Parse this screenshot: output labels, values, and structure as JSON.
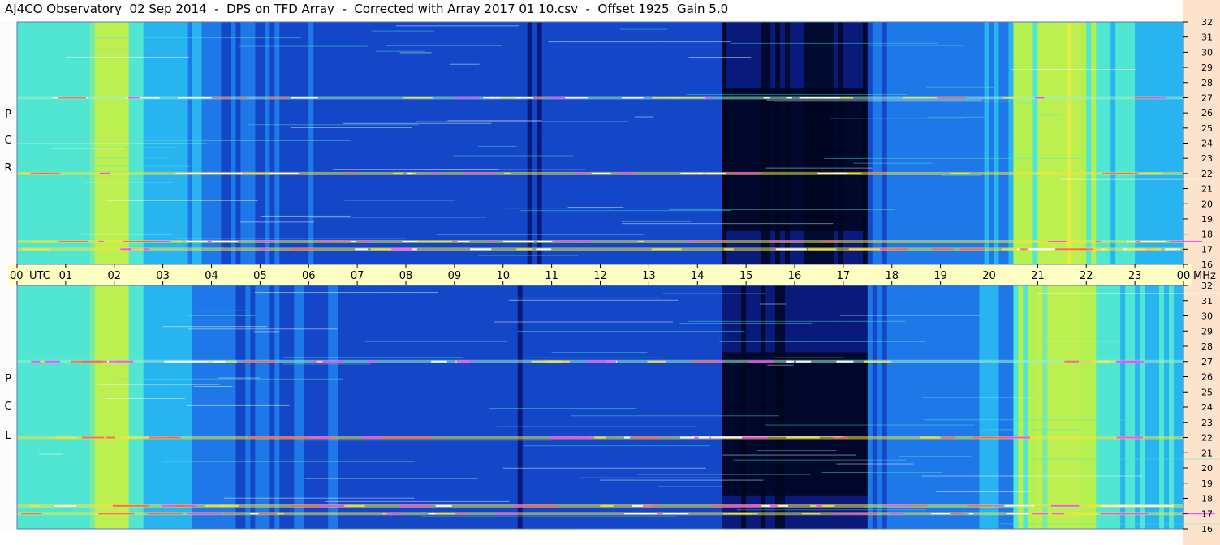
{
  "title": "AJ4CO Observatory  02 Sep 2014  -  DPS on TFD Array  -  Corrected with Array 2017 01 10.csv  -  Offset 1925  Gain 5.0",
  "panels": [
    {
      "name": "RCP",
      "polarization_letters": [
        "R",
        "C",
        "P"
      ]
    },
    {
      "name": "LCP",
      "polarization_letters": [
        "L",
        "C",
        "P"
      ]
    }
  ],
  "time_axis": {
    "ticks": [
      "00",
      "01",
      "02",
      "03",
      "04",
      "05",
      "06",
      "07",
      "08",
      "09",
      "10",
      "11",
      "12",
      "13",
      "14",
      "15",
      "16",
      "17",
      "18",
      "19",
      "20",
      "21",
      "22",
      "23",
      "00"
    ],
    "start_unit": "UTC",
    "end_unit": "MHz"
  },
  "freq_axis": {
    "ticks": [
      "32",
      "31",
      "30",
      "29",
      "28",
      "27",
      "26",
      "25",
      "24",
      "23",
      "22",
      "21",
      "20",
      "19",
      "18",
      "17",
      "16"
    ]
  },
  "chart_data": {
    "type": "heatmap",
    "title": "AJ4CO Observatory  02 Sep 2014  -  DPS on TFD Array  -  Corrected with Array 2017 01 10.csv  -  Offset 1925  Gain 5.0",
    "xlabel": "UTC",
    "ylabel": "MHz",
    "x_range_hours_utc": [
      0,
      24
    ],
    "y_range_mhz": [
      16,
      32
    ],
    "panels": [
      "RCP",
      "LCP"
    ],
    "colormap": [
      "#000a30",
      "#0a1a7a",
      "#1446c8",
      "#1e78e8",
      "#28b4f0",
      "#50e6d2",
      "#b4f050",
      "#f0e640",
      "#ff6060",
      "#ff40ff",
      "#ffffff"
    ],
    "bright_time_bands_utc": [
      [
        1.5,
        2.3
      ],
      [
        21.0,
        21.9
      ]
    ],
    "dark_region_utc": [
      14.5,
      17.5
    ],
    "interference_freqs_mhz": [
      27.0,
      17.5,
      17.0,
      22.0
    ]
  }
}
